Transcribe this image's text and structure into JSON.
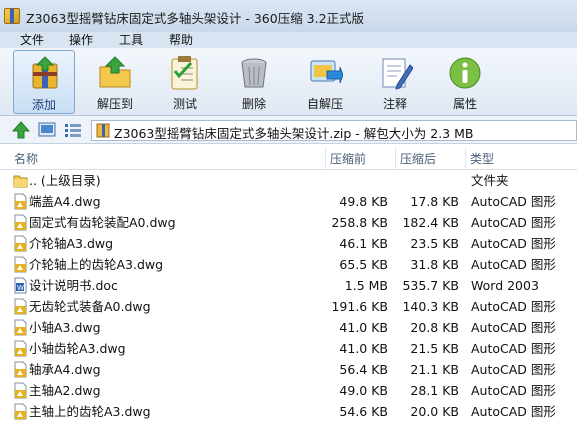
{
  "window": {
    "title": "Z3063型摇臂钻床固定式多轴头架设计 - 360压缩 3.2正式版"
  },
  "menu": [
    "文件",
    "操作",
    "工具",
    "帮助"
  ],
  "toolbar": [
    {
      "label": "添加",
      "icon": "add-archive-icon",
      "active": true
    },
    {
      "label": "解压到",
      "icon": "extract-to-icon",
      "active": false
    },
    {
      "label": "测试",
      "icon": "test-checklist-icon",
      "active": false
    },
    {
      "label": "删除",
      "icon": "delete-trashcan-icon",
      "active": false
    },
    {
      "label": "自解压",
      "icon": "self-extract-icon",
      "active": false
    },
    {
      "label": "注释",
      "icon": "comment-icon",
      "active": false
    },
    {
      "label": "属性",
      "icon": "info-icon",
      "active": false
    }
  ],
  "address": {
    "text": "Z3063型摇臂钻床固定式多轴头架设计.zip - 解包大小为 2.3 MB"
  },
  "columns": {
    "name": "名称",
    "size": "压缩前",
    "packed": "压缩后",
    "type": "类型"
  },
  "files": [
    {
      "name": ".. (上级目录)",
      "size": "",
      "packed": "",
      "type": "文件夹",
      "icon": "folder-icon"
    },
    {
      "name": "端盖A4.dwg",
      "size": "49.8 KB",
      "packed": "17.8 KB",
      "type": "AutoCAD 图形",
      "icon": "dwg-file-icon"
    },
    {
      "name": "固定式有齿轮装配A0.dwg",
      "size": "258.8 KB",
      "packed": "182.4 KB",
      "type": "AutoCAD 图形",
      "icon": "dwg-file-icon"
    },
    {
      "name": "介轮轴A3.dwg",
      "size": "46.1 KB",
      "packed": "23.5 KB",
      "type": "AutoCAD 图形",
      "icon": "dwg-file-icon"
    },
    {
      "name": "介轮轴上的齿轮A3.dwg",
      "size": "65.5 KB",
      "packed": "31.8 KB",
      "type": "AutoCAD 图形",
      "icon": "dwg-file-icon"
    },
    {
      "name": "设计说明书.doc",
      "size": "1.5 MB",
      "packed": "535.7 KB",
      "type": "Word 2003",
      "icon": "word-doc-icon"
    },
    {
      "name": "无齿轮式装备A0.dwg",
      "size": "191.6 KB",
      "packed": "140.3 KB",
      "type": "AutoCAD 图形",
      "icon": "dwg-file-icon"
    },
    {
      "name": "小轴A3.dwg",
      "size": "41.0 KB",
      "packed": "20.8 KB",
      "type": "AutoCAD 图形",
      "icon": "dwg-file-icon"
    },
    {
      "name": "小轴齿轮A3.dwg",
      "size": "41.0 KB",
      "packed": "21.5 KB",
      "type": "AutoCAD 图形",
      "icon": "dwg-file-icon"
    },
    {
      "name": "轴承A4.dwg",
      "size": "56.4 KB",
      "packed": "21.1 KB",
      "type": "AutoCAD 图形",
      "icon": "dwg-file-icon"
    },
    {
      "name": "主轴A2.dwg",
      "size": "49.0 KB",
      "packed": "28.1 KB",
      "type": "AutoCAD 图形",
      "icon": "dwg-file-icon"
    },
    {
      "name": "主轴上的齿轮A3.dwg",
      "size": "54.6 KB",
      "packed": "20.0 KB",
      "type": "AutoCAD 图形",
      "icon": "dwg-file-icon"
    }
  ]
}
